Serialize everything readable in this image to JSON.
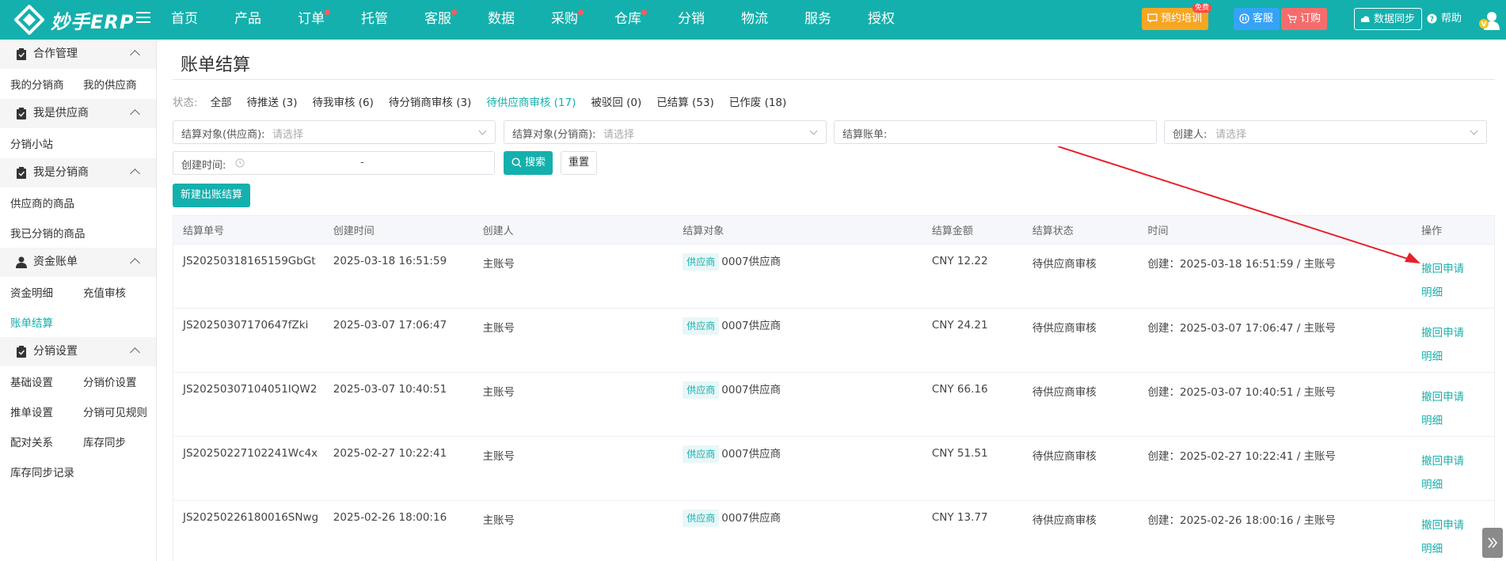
{
  "app": {
    "logo_text": "妙手ERP"
  },
  "nav": [
    {
      "label": "首页",
      "dot": false
    },
    {
      "label": "产品",
      "dot": false
    },
    {
      "label": "订单",
      "dot": true
    },
    {
      "label": "托管",
      "dot": false
    },
    {
      "label": "客服",
      "dot": true
    },
    {
      "label": "数据",
      "dot": false
    },
    {
      "label": "采购",
      "dot": true
    },
    {
      "label": "仓库",
      "dot": true
    },
    {
      "label": "分销",
      "dot": false
    },
    {
      "label": "物流",
      "dot": false
    },
    {
      "label": "服务",
      "dot": false
    },
    {
      "label": "授权",
      "dot": false
    }
  ],
  "top_tools": {
    "training": "预约培训",
    "free_badge": "免费",
    "service": "客服",
    "order": "订购",
    "sync": "数据同步",
    "help": "帮助"
  },
  "sidebar": {
    "groups": [
      {
        "title": "合作管理",
        "rows": [
          [
            "我的分销商",
            "我的供应商"
          ]
        ]
      },
      {
        "title": "我是供应商",
        "rows": [
          [
            "分销小站"
          ]
        ]
      },
      {
        "title": "我是分销商",
        "rows": [
          [
            "供应商的商品"
          ],
          [
            "我已分销的商品"
          ]
        ]
      },
      {
        "title": "资金账单",
        "rows": [
          [
            "资金明细",
            "充值审核"
          ],
          [
            "账单结算"
          ]
        ]
      },
      {
        "title": "分销设置",
        "rows": [
          [
            "基础设置",
            "分销价设置"
          ],
          [
            "推单设置",
            "分销可见规则"
          ],
          [
            "配对关系",
            "库存同步"
          ],
          [
            "库存同步记录"
          ]
        ]
      }
    ],
    "active_item": "账单结算"
  },
  "page": {
    "title": "账单结算",
    "status_label": "状态:",
    "status_tabs": [
      "全部",
      "待推送 (3)",
      "待我审核 (6)",
      "待分销商审核 (3)",
      "待供应商审核 (17)",
      "被驳回 (0)",
      "已结算 (53)",
      "已作废 (18)"
    ],
    "active_status": "待供应商审核 (17)",
    "filters": {
      "supplier_label": "结算对象(供应商):",
      "supplier_placeholder": "请选择",
      "distributor_label": "结算对象(分销商):",
      "distributor_placeholder": "请选择",
      "bill_label": "结算账单:",
      "creator_label": "创建人:",
      "creator_placeholder": "请选择",
      "created_time_label": "创建时间:",
      "range_separator": "-"
    },
    "search_button": "搜索",
    "reset_button": "重置",
    "new_button": "新建出账结算"
  },
  "table": {
    "headers": [
      "结算单号",
      "创建时间",
      "创建人",
      "结算对象",
      "结算金额",
      "结算状态",
      "时间",
      "操作"
    ],
    "rows": [
      {
        "no": "JS20250318165159GbGt",
        "created": "2025-03-18 16:51:59",
        "creator": "主账号",
        "tag": "供应商",
        "target": "0007供应商",
        "amount": "CNY 12.22",
        "status": "待供应商审核",
        "time": "创建：2025-03-18 16:51:59 / 主账号",
        "op1": "撤回申请",
        "op2": "明细"
      },
      {
        "no": "JS20250307170647fZki",
        "created": "2025-03-07 17:06:47",
        "creator": "主账号",
        "tag": "供应商",
        "target": "0007供应商",
        "amount": "CNY 24.21",
        "status": "待供应商审核",
        "time": "创建：2025-03-07 17:06:47 / 主账号",
        "op1": "撤回申请",
        "op2": "明细"
      },
      {
        "no": "JS20250307104051IQW2",
        "created": "2025-03-07 10:40:51",
        "creator": "主账号",
        "tag": "供应商",
        "target": "0007供应商",
        "amount": "CNY 66.16",
        "status": "待供应商审核",
        "time": "创建：2025-03-07 10:40:51 / 主账号",
        "op1": "撤回申请",
        "op2": "明细"
      },
      {
        "no": "JS20250227102241Wc4x",
        "created": "2025-02-27 10:22:41",
        "creator": "主账号",
        "tag": "供应商",
        "target": "0007供应商",
        "amount": "CNY 51.51",
        "status": "待供应商审核",
        "time": "创建：2025-02-27 10:22:41 / 主账号",
        "op1": "撤回申请",
        "op2": "明细"
      },
      {
        "no": "JS20250226180016SNwg",
        "created": "2025-02-26 18:00:16",
        "creator": "主账号",
        "tag": "供应商",
        "target": "0007供应商",
        "amount": "CNY 13.77",
        "status": "待供应商审核",
        "time": "创建：2025-02-26 18:00:16 / 主账号",
        "op1": "撤回申请",
        "op2": "明细"
      }
    ]
  },
  "colors": {
    "brand": "#14b0ad",
    "annotation_arrow": "#e8202a"
  }
}
